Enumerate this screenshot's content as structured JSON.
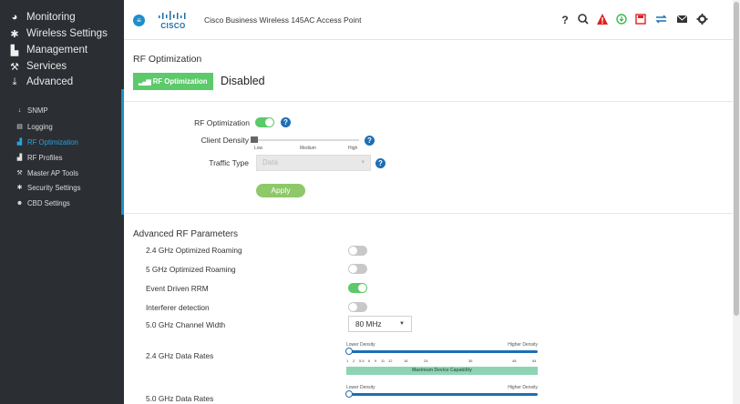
{
  "sidebar": {
    "items": [
      {
        "label": "Monitoring",
        "icon": "dashboard-icon"
      },
      {
        "label": "Wireless Settings",
        "icon": "gear-icon"
      },
      {
        "label": "Management",
        "icon": "management-icon"
      },
      {
        "label": "Services",
        "icon": "wrench-icon"
      },
      {
        "label": "Advanced",
        "icon": "download-icon"
      }
    ],
    "sub_items": [
      {
        "label": "SNMP",
        "icon": "arrow-down-icon",
        "active": false
      },
      {
        "label": "Logging",
        "icon": "file-icon",
        "active": false
      },
      {
        "label": "RF Optimization",
        "icon": "signal-bars-icon",
        "active": true
      },
      {
        "label": "RF Profiles",
        "icon": "signal-bars-icon",
        "active": false
      },
      {
        "label": "Master AP Tools",
        "icon": "wrench-icon",
        "active": false
      },
      {
        "label": "Security Settings",
        "icon": "gear-icon",
        "active": false
      },
      {
        "label": "CBD Settings",
        "icon": "users-icon",
        "active": false
      }
    ]
  },
  "header": {
    "logo_text": "CISCO",
    "title": "Cisco Business Wireless 145AC Access Point",
    "icons": [
      {
        "name": "help-icon",
        "glyph": "?",
        "color": "#333333"
      },
      {
        "name": "search-icon",
        "glyph": "⚲",
        "color": "#333333"
      },
      {
        "name": "alert-icon",
        "glyph": "▲",
        "color": "#e02020"
      },
      {
        "name": "download-icon",
        "glyph": "⊕",
        "color": "#3cb84a"
      },
      {
        "name": "save-icon",
        "glyph": "▣",
        "color": "#e02020"
      },
      {
        "name": "transfer-icon",
        "glyph": "⇄",
        "color": "#1e6eb4"
      },
      {
        "name": "mail-icon",
        "glyph": "✉",
        "color": "#333333"
      },
      {
        "name": "settings-icon",
        "glyph": "✱",
        "color": "#333333"
      }
    ]
  },
  "page": {
    "title": "RF Optimization",
    "tab_label": "RF Optimization",
    "status": "Disabled"
  },
  "form": {
    "rf_optimization_label": "RF Optimization",
    "rf_optimization_on": true,
    "client_density_label": "Client Density",
    "density_low": "Low",
    "density_medium": "Medium",
    "density_high": "High",
    "density_level": 0,
    "traffic_type_label": "Traffic Type",
    "traffic_type_value": "Data",
    "apply_label": "Apply"
  },
  "advanced": {
    "title": "Advanced RF Parameters",
    "roaming_24_label": "2.4 GHz Optimized Roaming",
    "roaming_24_on": false,
    "roaming_5_label": "5 GHz Optimized Roaming",
    "roaming_5_on": false,
    "event_rrm_label": "Event Driven RRM",
    "event_rrm_on": true,
    "interferer_label": "Interferer detection",
    "interferer_on": false,
    "channel_width_label": "5.0 GHz Channel Width",
    "channel_width_value": "80 MHz",
    "rates_24_label": "2.4 GHz Data Rates",
    "rates_5_label": "5.0 GHz Data Rates",
    "lower_density": "Lower Density",
    "higher_density": "Higher Density",
    "rate_ticks": [
      "1",
      "2",
      "5.5",
      "6",
      "9",
      "11",
      "12",
      "18",
      "24",
      "36",
      "48",
      "54"
    ],
    "capability_label": "Maximum Device Capability"
  },
  "colors": {
    "accent_green": "#5cc96a",
    "accent_blue": "#1e8ec8",
    "sidebar_bg": "#2b2e33"
  }
}
